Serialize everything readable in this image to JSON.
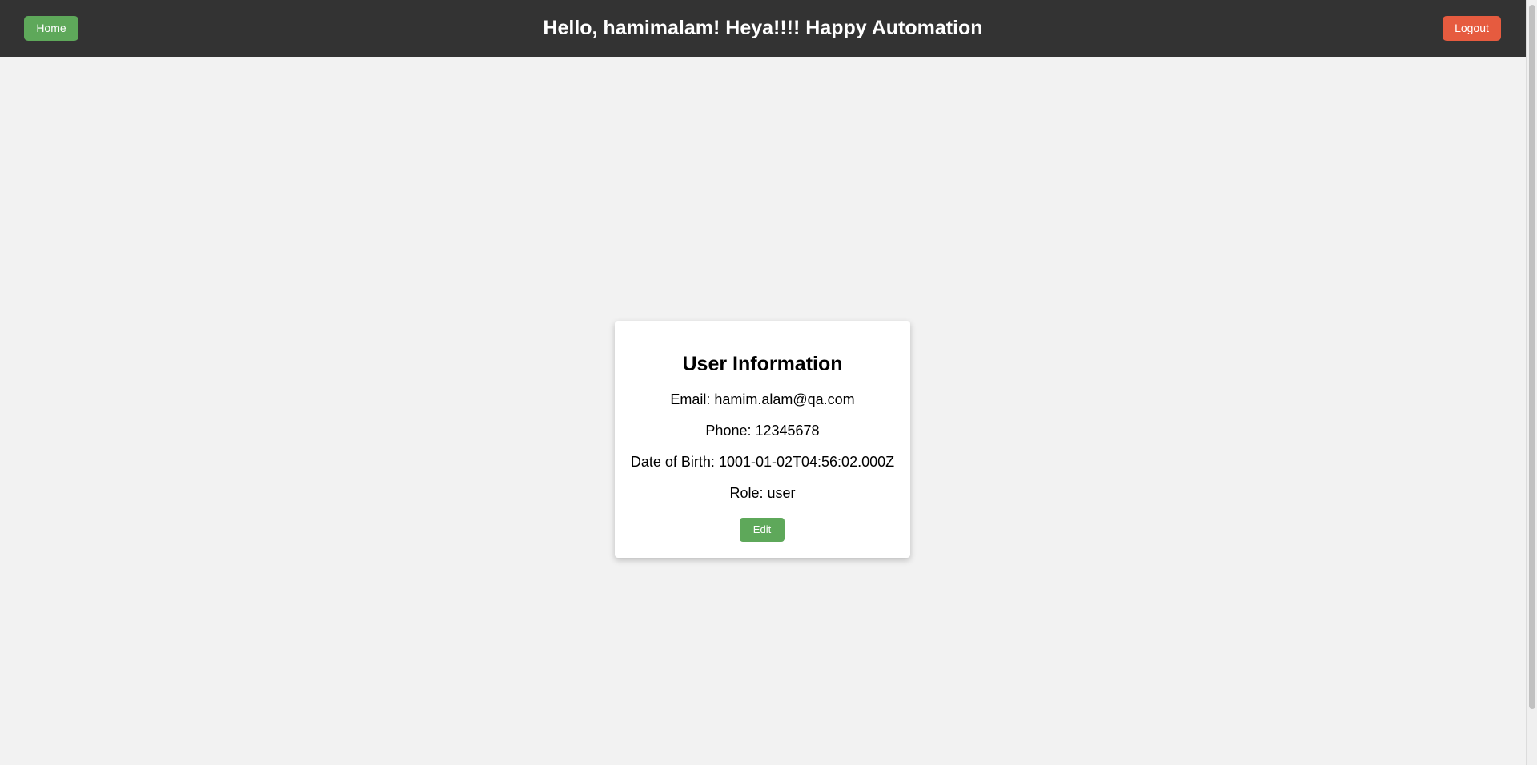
{
  "header": {
    "home_label": "Home",
    "title": "Hello, hamimalam! Heya!!!! Happy Automation",
    "logout_label": "Logout"
  },
  "user_info": {
    "title": "User Information",
    "email": "Email: hamim.alam@qa.com",
    "phone": "Phone: 12345678",
    "dob": "Date of Birth: 1001-01-02T04:56:02.000Z",
    "role": "Role: user",
    "edit_label": "Edit"
  },
  "colors": {
    "navbar": "#333333",
    "home_button": "#5ea85a",
    "logout_button": "#e65b3f",
    "edit_button": "#5ea85a",
    "background": "#f2f2f2"
  }
}
